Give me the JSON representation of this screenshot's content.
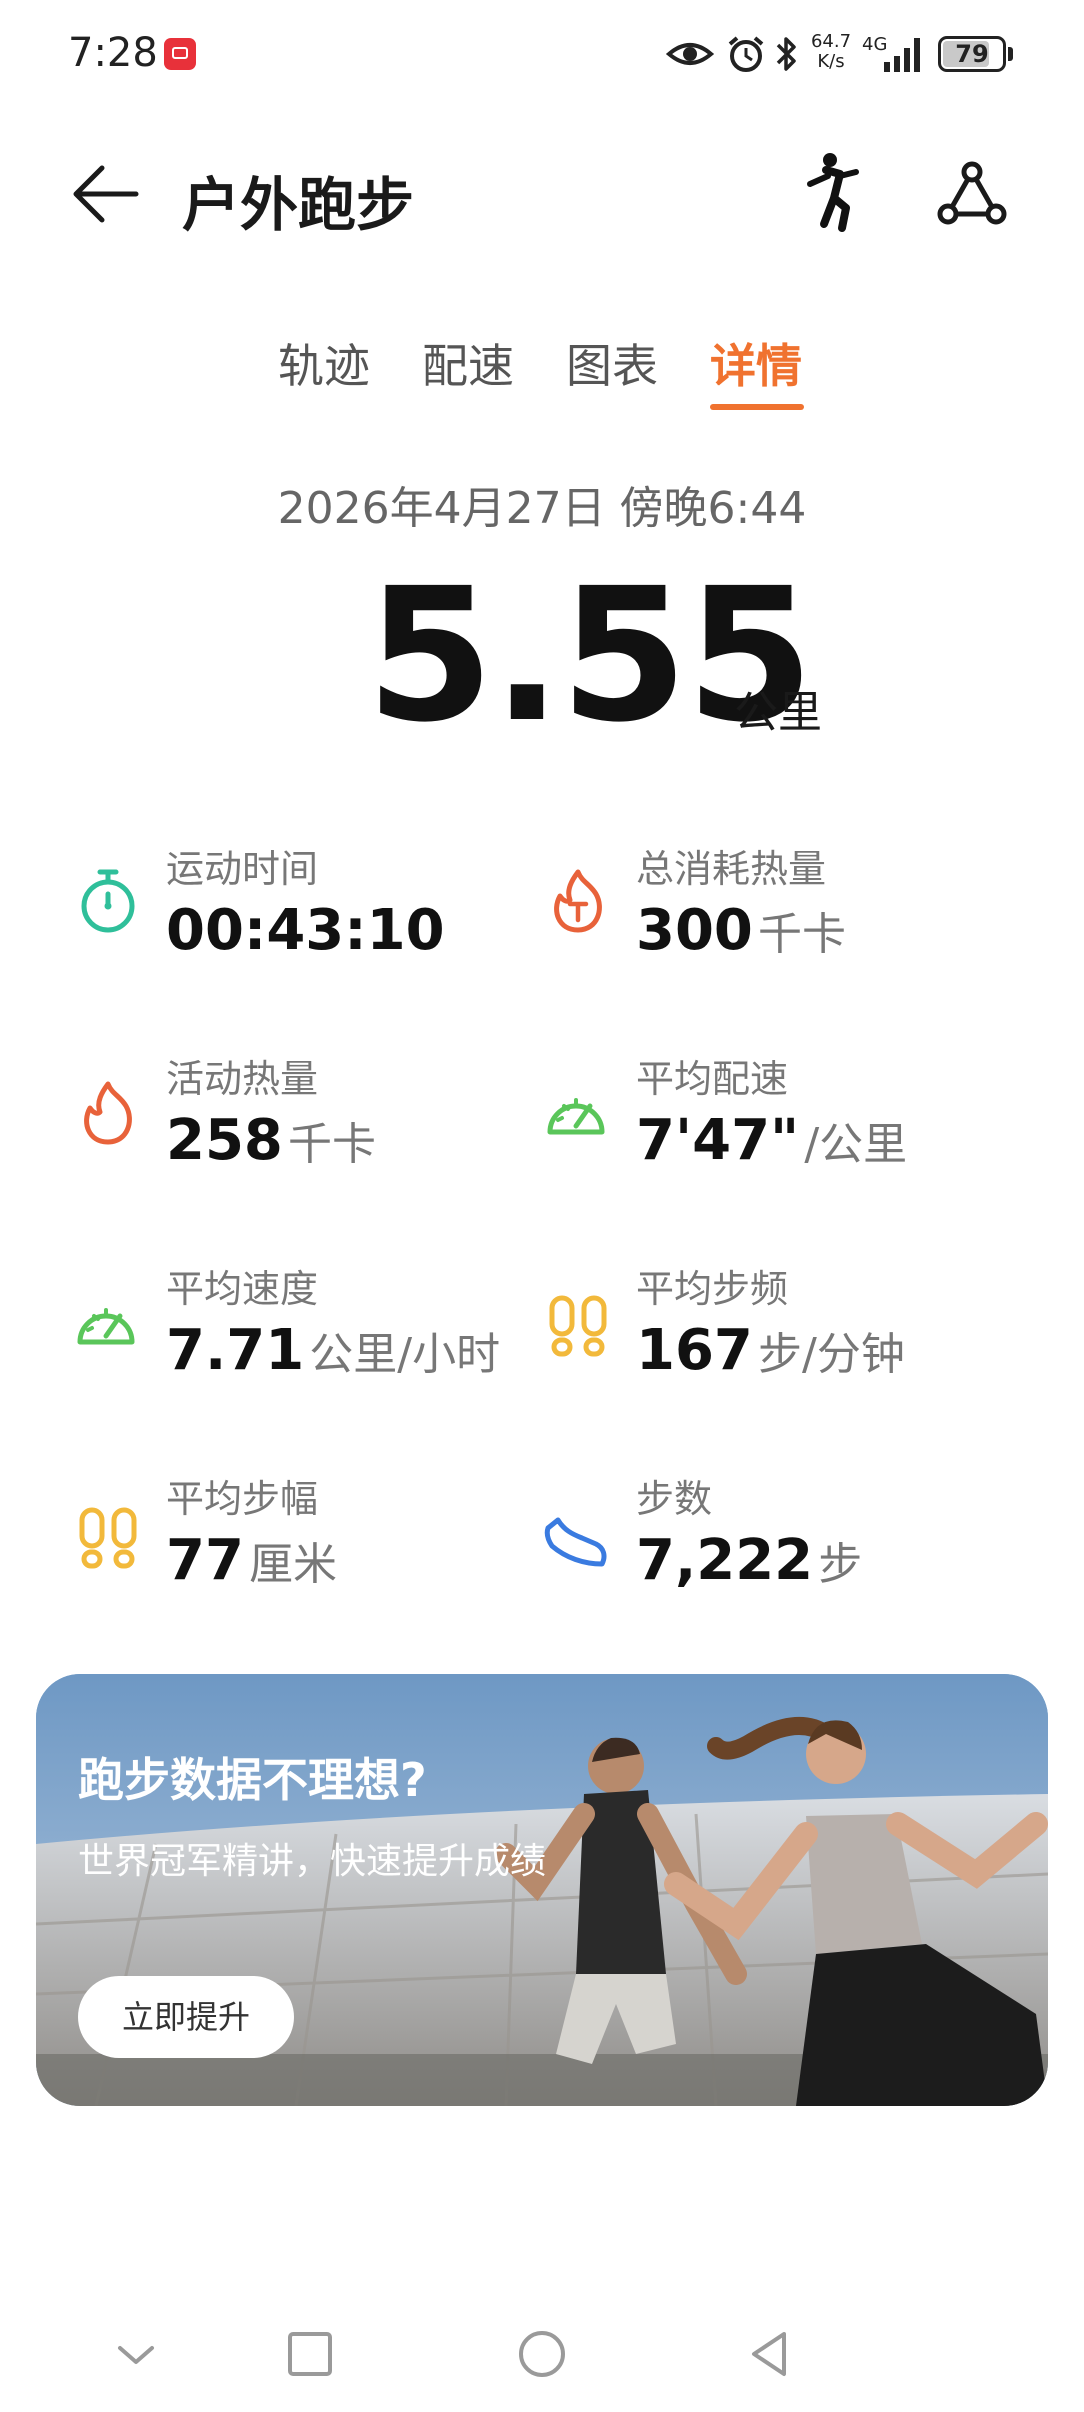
{
  "status_bar": {
    "time": "7:28",
    "net_speed_value": "64.7",
    "net_speed_unit": "K/s",
    "net_type": "4G",
    "battery": "79",
    "icons": [
      "app-notification-icon",
      "eye-icon",
      "alarm-icon",
      "bluetooth-icon",
      "signal-icon",
      "battery-icon"
    ]
  },
  "header": {
    "title": "户外跑步",
    "icons": [
      "back-arrow-icon",
      "runner-icon",
      "share-icon"
    ]
  },
  "tabs": [
    {
      "label": "轨迹",
      "active": false
    },
    {
      "label": "配速",
      "active": false
    },
    {
      "label": "图表",
      "active": false
    },
    {
      "label": "详情",
      "active": true
    }
  ],
  "summary": {
    "date": "2026年4月27日 傍晚6:44",
    "distance": "5.55",
    "distance_unit": "公里"
  },
  "stats": [
    {
      "label": "运动时间",
      "value": "00:43:10",
      "unit": "",
      "icon": "stopwatch-icon",
      "color": "#2fbf9a"
    },
    {
      "label": "总消耗热量",
      "value": "300",
      "unit": "千卡",
      "icon": "total-calories-icon",
      "color": "#e8623a"
    },
    {
      "label": "活动热量",
      "value": "258",
      "unit": "千卡",
      "icon": "flame-icon",
      "color": "#e8623a"
    },
    {
      "label": "平均配速",
      "value": "7'47\"",
      "unit": "/公里",
      "icon": "pace-gauge-icon",
      "color": "#5ac65a"
    },
    {
      "label": "平均速度",
      "value": "7.71",
      "unit": "公里/小时",
      "icon": "speed-gauge-icon",
      "color": "#5ac65a"
    },
    {
      "label": "平均步频",
      "value": "167",
      "unit": "步/分钟",
      "icon": "footprints-icon",
      "color": "#f2b93b"
    },
    {
      "label": "平均步幅",
      "value": "77",
      "unit": "厘米",
      "icon": "footprints-icon",
      "color": "#f2b93b"
    },
    {
      "label": "步数",
      "value": "7,222",
      "unit": "步",
      "icon": "shoe-icon",
      "color": "#3a7be0"
    }
  ],
  "banner": {
    "title": "跑步数据不理想?",
    "subtitle": "世界冠军精讲，快速提升成绩",
    "button": "立即提升"
  },
  "nav_bar": {
    "icons": [
      "collapse-icon",
      "recents-icon",
      "home-icon",
      "back-icon"
    ]
  },
  "colors": {
    "accent": "#f0722f",
    "text_primary": "#111111",
    "text_secondary": "#777777"
  }
}
